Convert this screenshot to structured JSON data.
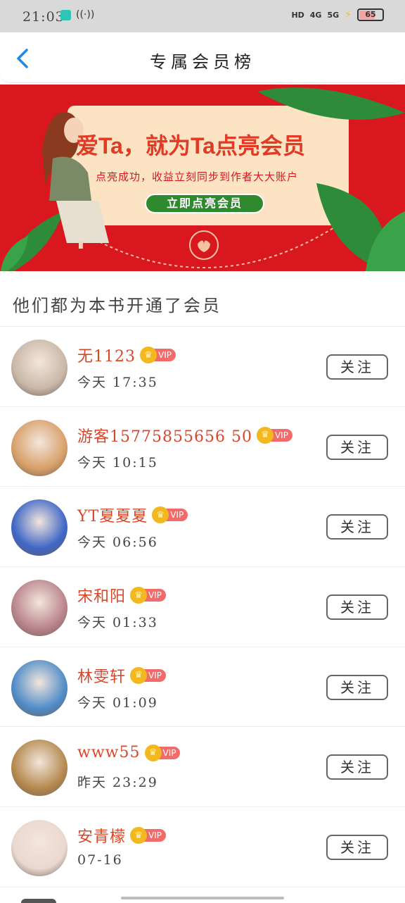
{
  "status_bar": {
    "time": "21:03",
    "hd": "HD",
    "net1": "4G",
    "net2": "5G",
    "battery": "65"
  },
  "header": {
    "title": "专属会员榜"
  },
  "banner": {
    "headline": "爱Ta，就为Ta点亮会员",
    "subtitle": "点亮成功，收益立刻同步到作者大大账户",
    "cta": "立即点亮会员"
  },
  "section": {
    "title": "他们都为本书开通了会员"
  },
  "members": [
    {
      "name": "无1123",
      "time": "今天 17:35",
      "vip": "VIP",
      "follow": "关注",
      "avatar_color": "#c9b8a8"
    },
    {
      "name": "游客15775855656 50",
      "time": "今天 10:15",
      "vip": "VIP",
      "follow": "关注",
      "avatar_color": "#d8a06a"
    },
    {
      "name": "YT夏夏夏",
      "time": "今天 06:56",
      "vip": "VIP",
      "follow": "关注",
      "avatar_color": "#3f67c7"
    },
    {
      "name": "宋和阳",
      "time": "今天 01:33",
      "vip": "VIP",
      "follow": "关注",
      "avatar_color": "#b9848c"
    },
    {
      "name": "林雯轩",
      "time": "今天 01:09",
      "vip": "VIP",
      "follow": "关注",
      "avatar_color": "#4f8cc8"
    },
    {
      "name": "www55",
      "time": "昨天 23:29",
      "vip": "VIP",
      "follow": "关注",
      "avatar_color": "#b5894f"
    },
    {
      "name": "安青檬",
      "time": "07-16",
      "vip": "VIP",
      "follow": "关注",
      "avatar_color": "#e9d8cf"
    }
  ],
  "colors": {
    "accent": "#d9472b",
    "banner_red": "#d8171f",
    "cta_green": "#2f8a2f",
    "back_blue": "#1e88e5"
  }
}
